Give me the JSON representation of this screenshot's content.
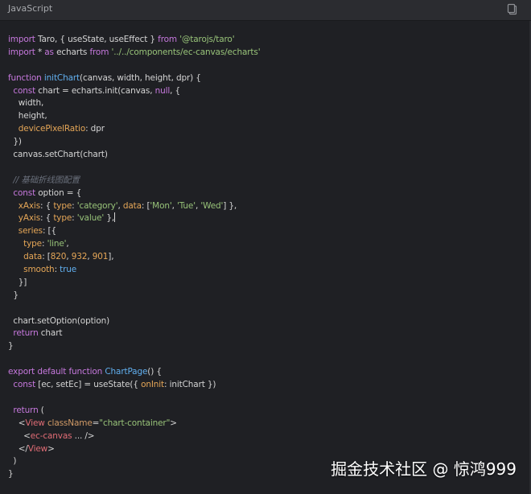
{
  "header": {
    "language": "JavaScript",
    "copy_icon": "clipboard-icon"
  },
  "colors": {
    "keyword": "#c678dd",
    "function": "#61afef",
    "string": "#98c379",
    "property": "#e5a657",
    "comment": "#6b717d",
    "tag": "#e06c75",
    "text": "#d4d4d4",
    "background": "#1f2024"
  },
  "code": {
    "l1": {
      "a": "import",
      "b": " Taro, { useState, useEffect } ",
      "c": "from",
      "d": " ",
      "e": "'@tarojs/taro'"
    },
    "l2": {
      "a": "import",
      "b": " * ",
      "c": "as",
      "d": " echarts ",
      "e": "from",
      "f": " ",
      "g": "'../../components/ec-canvas/echarts'"
    },
    "l4": {
      "a": "function",
      "b": " ",
      "c": "initChart",
      "d": "(canvas, width, height, dpr) {"
    },
    "l5": {
      "a": "  ",
      "b": "const",
      "c": " chart = echarts.init(canvas, ",
      "d": "null",
      ".e": "",
      "e": ", {"
    },
    "l6": "    width,",
    "l7": "    height,",
    "l8": {
      "a": "    ",
      "b": "devicePixelRatio",
      ".c": "",
      "c": ": dpr"
    },
    "l9": "  })",
    "l10": "  canvas.setChart(chart)",
    "l12": "  // 基础折线图配置",
    "l13": {
      "a": "  ",
      "b": "const",
      "c": " option = {"
    },
    "l14": {
      "a": "    ",
      "b": "xAxis",
      "c": ": { ",
      "d": "type",
      "e": ": ",
      "f": "'category'",
      "g": ", ",
      "h": "data",
      "i": ": [",
      "j": "'Mon'",
      "k": ", ",
      "l": "'Tue'",
      "m": ", ",
      "n": "'Wed'",
      "o": "] },"
    },
    "l15": {
      "a": "    ",
      "b": "yAxis",
      "c": ": { ",
      "d": "type",
      "e": ": ",
      "f": "'value'",
      "g": " },"
    },
    "l16": {
      "a": "    ",
      "b": "series",
      "c": ": [{"
    },
    "l17": {
      "a": "      ",
      "b": "type",
      "c": ": ",
      "d": "'line'",
      "e": ","
    },
    "l18": {
      "a": "      ",
      "b": "data",
      "c": ": [",
      "d": "820",
      "e": ", ",
      "f": "932",
      "g": ", ",
      "h": "901",
      "i": "],"
    },
    "l19": {
      "a": "      ",
      "b": "smooth",
      "c": ": ",
      "d": "true"
    },
    "l20": "    }]",
    "l21": "  }",
    "l23": "  chart.setOption(option)",
    "l24": {
      "a": "  ",
      "b": "return",
      "c": " chart"
    },
    "l25": "}",
    "l27": {
      "a": "export",
      "b": " ",
      "c": "default",
      "d": " ",
      "e": "function",
      "f": " ",
      "g": "ChartPage",
      "h": "() {"
    },
    "l28": {
      "a": "  ",
      "b": "const",
      "c": " [ec, setEc] = useState({ ",
      "d": "onInit",
      ".e": "",
      "e": ": initChart })"
    },
    "l30": {
      "a": "  ",
      "b": "return",
      "c": " ("
    },
    "l31": {
      "a": "    <",
      "b": "View",
      "c": " ",
      "d": "className",
      "e": "=",
      "f": "\"chart-container\"",
      "g": ">"
    },
    "l32": {
      "a": "      <",
      "b": "ec-canvas",
      "c": " ... />"
    },
    "l33": {
      "a": "    </",
      "b": "View",
      "c": ">"
    },
    "l34": "  )",
    "l35": "}"
  },
  "watermark": "掘金技术社区 @ 惊鸿999"
}
